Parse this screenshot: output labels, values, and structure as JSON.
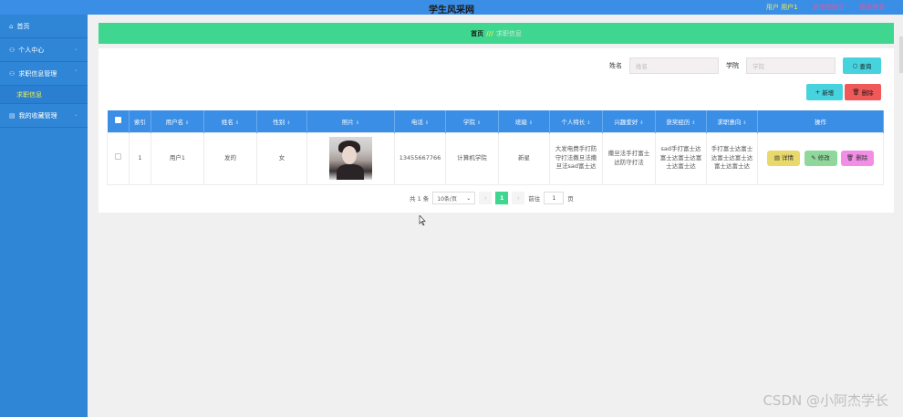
{
  "header": {
    "app_title": "学生风采网",
    "user_label": "用户 用户1",
    "link_front": "退出到前台",
    "link_logout": "退出登录"
  },
  "sidebar": {
    "items": [
      {
        "label": "首页",
        "icon": "home-icon"
      },
      {
        "label": "个人中心",
        "icon": "user-icon"
      },
      {
        "label": "求职信息管理",
        "icon": "user-icon",
        "sub": "求职信息"
      },
      {
        "label": "我的收藏管理",
        "icon": "document-icon"
      }
    ]
  },
  "breadcrumb": {
    "home": "首页",
    "sep": "///",
    "current": "求职信息"
  },
  "search": {
    "name_label": "姓名",
    "name_placeholder": "姓名",
    "college_label": "学院",
    "college_placeholder": "学院",
    "button": "查询"
  },
  "toolbar": {
    "add": "新增",
    "delete": "删除"
  },
  "table": {
    "headers": [
      "索引",
      "用户名",
      "姓名",
      "性别",
      "照片",
      "电话",
      "学院",
      "班級",
      "个人特长",
      "兴趣爱好",
      "获奖经历",
      "求职意向",
      "操作"
    ],
    "rows": [
      {
        "index": "1",
        "username": "用户1",
        "name": "发的",
        "gender": "女",
        "phone": "13455667766",
        "college": "计算机学院",
        "class": "新星",
        "skills": "大发电费手打防守打法撒旦法撒旦法sad富士达",
        "hobbies": "撒旦法手打富士达防守打法",
        "awards": "sad手打富士达富士达富士达富士达富士达",
        "intent": "手打富士达富士达富士达富士达富士达富士达",
        "op_detail": "详情",
        "op_edit": "修改",
        "op_delete": "删除"
      }
    ]
  },
  "pagination": {
    "total": "共 1 条",
    "page_size": "10条/页",
    "current_page": "1",
    "goto_label": "前往",
    "goto_value": "1",
    "page_suffix": "页"
  },
  "watermark": "CSDN @小阿杰学长"
}
